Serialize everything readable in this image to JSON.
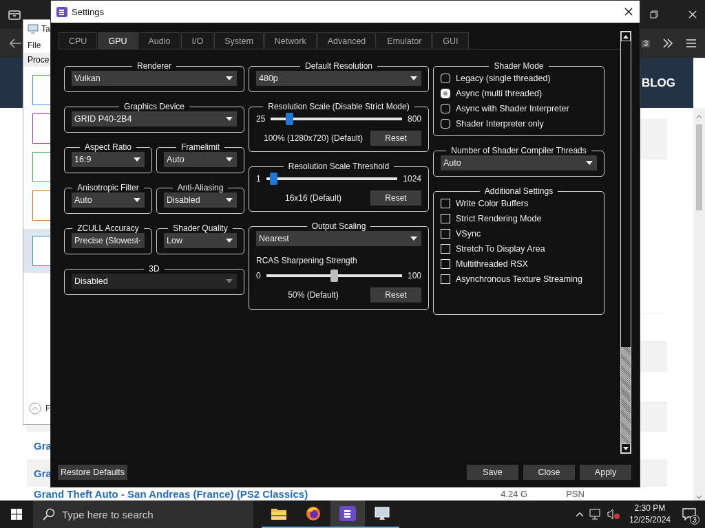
{
  "browser": {
    "badge": "3",
    "site_title": "BLOG",
    "rows": [
      {
        "title": "Gra"
      },
      {
        "title": "Gra"
      },
      {
        "title": "Grand Theft Auto - San Andreas (France) (PS2 Classics)",
        "size": "4.24 G",
        "platform": "PSN"
      }
    ]
  },
  "task_manager": {
    "title": "Ta",
    "menu": "File",
    "tab": "Proce",
    "graphs": [
      {
        "color": "#4a90d0",
        "selected": false
      },
      {
        "color": "#a040b0",
        "selected": false
      },
      {
        "color": "#4caf50",
        "selected": false
      },
      {
        "color": "#c87030",
        "selected": false
      },
      {
        "color": "#3aa0a8",
        "selected": true
      }
    ],
    "footer": "F"
  },
  "dialog": {
    "title": "Settings",
    "tabs": [
      {
        "label": "CPU",
        "selected": false
      },
      {
        "label": "GPU",
        "selected": true
      },
      {
        "label": "Audio",
        "selected": false
      },
      {
        "label": "I/O",
        "selected": false
      },
      {
        "label": "System",
        "selected": false
      },
      {
        "label": "Network",
        "selected": false
      },
      {
        "label": "Advanced",
        "selected": false
      },
      {
        "label": "Emulator",
        "selected": false
      },
      {
        "label": "GUI",
        "selected": false
      }
    ],
    "columns": [
      [
        {
          "kind": "select",
          "title": "Renderer",
          "value": "Vulkan",
          "disabled": false
        },
        {
          "kind": "select",
          "title": "Graphics Device",
          "value": "GRID P40-2B4",
          "disabled": false
        },
        {
          "kind": "pair",
          "items": [
            {
              "title": "Aspect Ratio",
              "value": "16:9",
              "disabled": false
            },
            {
              "title": "Framelimit",
              "value": "Auto",
              "disabled": false
            }
          ]
        },
        {
          "kind": "pair",
          "items": [
            {
              "title": "Anisotropic Filter",
              "value": "Auto",
              "disabled": false
            },
            {
              "title": "Anti-Aliasing",
              "value": "Disabled",
              "disabled": false
            }
          ]
        },
        {
          "kind": "pair",
          "items": [
            {
              "title": "ZCULL Accuracy",
              "value": "Precise (Slowest",
              "disabled": false
            },
            {
              "title": "Shader Quality",
              "value": "Low",
              "disabled": false
            }
          ]
        },
        {
          "kind": "select",
          "title": "3D",
          "value": "Disabled",
          "disabled": true
        }
      ],
      [
        {
          "kind": "select",
          "title": "Default Resolution",
          "value": "480p",
          "disabled": false
        },
        {
          "kind": "slider",
          "title": "Resolution Scale (Disable Strict Mode)",
          "min": "25",
          "max": "800",
          "level": 0.12,
          "reading": "100% (1280x720) (Default)",
          "button": "Reset",
          "disabled": false
        },
        {
          "kind": "slider",
          "title": "Resolution Scale Threshold",
          "min": "1",
          "max": "1024",
          "level": 0.03,
          "reading": "16x16 (Default)",
          "button": "Reset",
          "disabled": false
        },
        {
          "kind": "scaling",
          "title": "Output Scaling",
          "value": "Nearest",
          "disabled": false,
          "label": "RCAS Sharpening Strength",
          "min": "0",
          "max": "100",
          "level": 0.5,
          "reading": "50% (Default)",
          "button": "Reset",
          "slider_disabled": true
        }
      ],
      [
        {
          "kind": "radios",
          "title": "Shader Mode",
          "options": [
            {
              "label": "Legacy (single threaded)",
              "selected": false
            },
            {
              "label": "Async (multi threaded)",
              "selected": true
            },
            {
              "label": "Async with Shader Interpreter",
              "selected": false
            },
            {
              "label": "Shader Interpreter only",
              "selected": false
            }
          ]
        },
        {
          "kind": "select",
          "title": "Number of Shader Compiler Threads",
          "value": "Auto",
          "disabled": false
        },
        {
          "kind": "checks",
          "title": "Additional Settings",
          "options": [
            {
              "label": "Write Color Buffers",
              "checked": false
            },
            {
              "label": "Strict Rendering Mode",
              "checked": false
            },
            {
              "label": "VSync",
              "checked": false
            },
            {
              "label": "Stretch To Display Area",
              "checked": false
            },
            {
              "label": "Multithreaded RSX",
              "checked": false
            },
            {
              "label": "Asynchronous Texture Streaming",
              "checked": false
            }
          ]
        }
      ]
    ],
    "footer": {
      "left": "Restore Defaults",
      "buttons": [
        "Save",
        "Close",
        "Apply"
      ]
    }
  },
  "taskbar": {
    "search_placeholder": "Type here to search",
    "apps": [
      {
        "kind": "folder",
        "active": false
      },
      {
        "kind": "browser",
        "active": false
      },
      {
        "kind": "app",
        "active": true
      },
      {
        "kind": "monitor",
        "active": false
      }
    ],
    "time": "2:30 PM",
    "date": "12/25/2024",
    "notifications": "3"
  }
}
